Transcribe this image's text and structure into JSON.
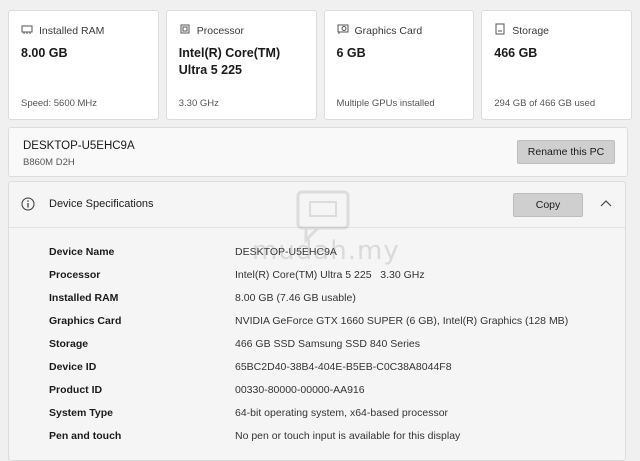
{
  "cards": [
    {
      "title": "Installed RAM",
      "icon": "ram-icon",
      "value": "8.00 GB",
      "sub": "Speed: 5600 MHz"
    },
    {
      "title": "Processor",
      "icon": "processor-icon",
      "value": "Intel(R) Core(TM) Ultra 5 225",
      "sub": "3.30 GHz"
    },
    {
      "title": "Graphics Card",
      "icon": "graphics-card-icon",
      "value": "6 GB",
      "sub": "Multiple GPUs installed"
    },
    {
      "title": "Storage",
      "icon": "storage-icon",
      "value": "466 GB",
      "sub": "294 GB of 466 GB used"
    }
  ],
  "pc": {
    "name": "DESKTOP-U5EHC9A",
    "model": "B860M D2H",
    "rename_label": "Rename this PC"
  },
  "specs": {
    "title": "Device Specifications",
    "copy_label": "Copy",
    "rows": [
      {
        "label": "Device Name",
        "value": "DESKTOP-U5EHC9A"
      },
      {
        "label": "Processor",
        "value": "Intel(R) Core(TM) Ultra 5 225   3.30 GHz"
      },
      {
        "label": "Installed RAM",
        "value": "8.00 GB (7.46 GB usable)"
      },
      {
        "label": "Graphics Card",
        "value": "NVIDIA GeForce GTX 1660 SUPER (6 GB), Intel(R) Graphics (128 MB)"
      },
      {
        "label": "Storage",
        "value": "466 GB SSD Samsung SSD 840 Series"
      },
      {
        "label": "Device ID",
        "value": "65BC2D40-38B4-404E-B5EB-C0C38A8044F8"
      },
      {
        "label": "Product ID",
        "value": "00330-80000-00000-AA916"
      },
      {
        "label": "System Type",
        "value": "64-bit operating system, x64-based processor"
      },
      {
        "label": "Pen and touch",
        "value": "No pen or touch input is available for this display"
      }
    ]
  },
  "watermark": "mudah.my"
}
